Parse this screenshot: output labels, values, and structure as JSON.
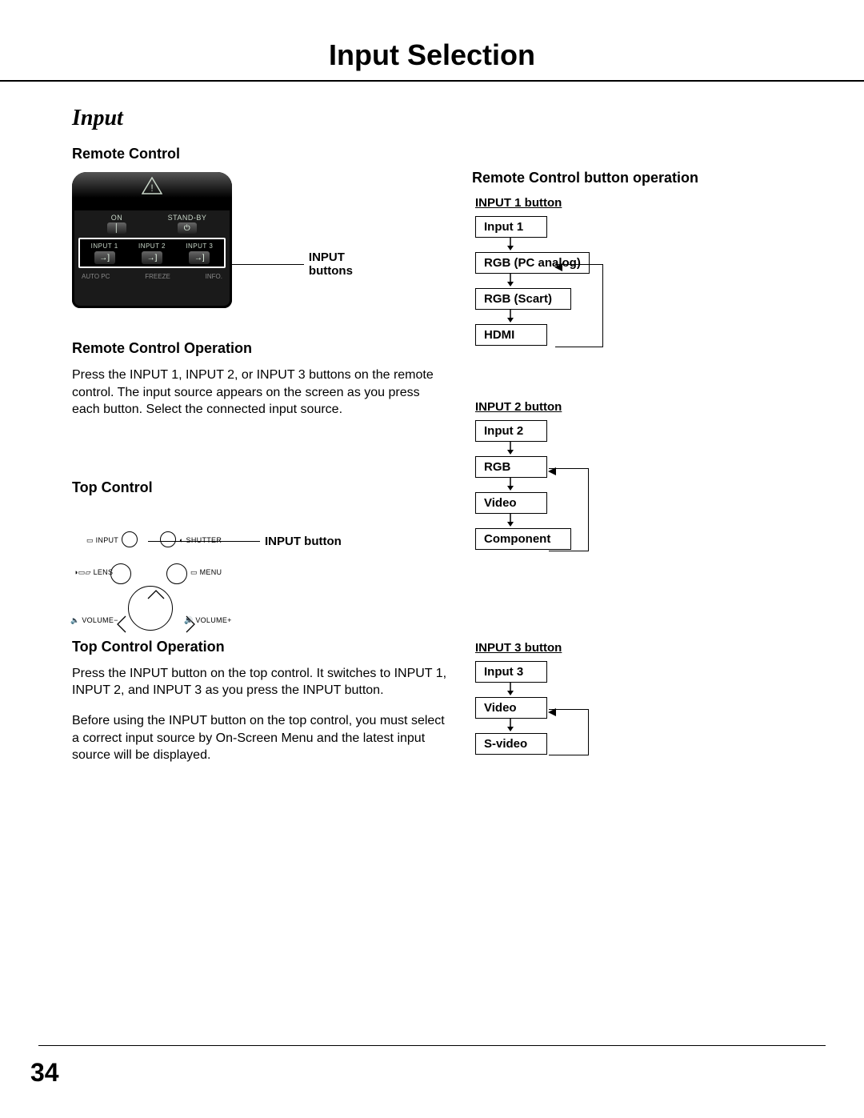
{
  "page": {
    "title": "Input Selection",
    "section": "Input",
    "number": "34"
  },
  "left": {
    "remote_heading": "Remote Control",
    "remote_callout": "INPUT buttons",
    "remote_keys": {
      "on": "ON",
      "standby": "STAND-BY",
      "in1": "INPUT 1",
      "in2": "INPUT 2",
      "in3": "INPUT 3",
      "autopc": "AUTO PC",
      "freeze": "FREEZE",
      "info": "INFO."
    },
    "rc_op_heading": "Remote Control Operation",
    "rc_op_para": "Press the INPUT 1, INPUT 2, or INPUT 3 buttons on the remote control. The input source appears on the screen as you press each button. Select the connected input source.",
    "top_heading": "Top Control",
    "top_callout": "INPUT button",
    "top_labels": {
      "input": "INPUT",
      "shutter": "SHUTTER",
      "lens": "LENS",
      "menu": "MENU",
      "volm": "VOLUME−",
      "volp": "VOLUME+"
    },
    "tc_op_heading": "Top Control Operation",
    "tc_op_para1": "Press the INPUT button on the top control. It switches to INPUT 1, INPUT 2, and INPUT 3 as you press the INPUT button.",
    "tc_op_para2": "Before using the INPUT button on the top control, you must select a correct input source by On-Screen Menu and the latest input source will be displayed."
  },
  "right": {
    "heading": "Remote Control button operation",
    "groups": [
      {
        "title": "INPUT 1 button",
        "head": "Input 1",
        "items": [
          "RGB (PC analog)",
          "RGB (Scart)",
          "HDMI"
        ]
      },
      {
        "title": "INPUT 2 button",
        "head": "Input 2",
        "items": [
          "RGB",
          "Video",
          "Component"
        ]
      },
      {
        "title": "INPUT 3 button",
        "head": "Input 3",
        "items": [
          "Video",
          "S-video"
        ]
      }
    ]
  }
}
